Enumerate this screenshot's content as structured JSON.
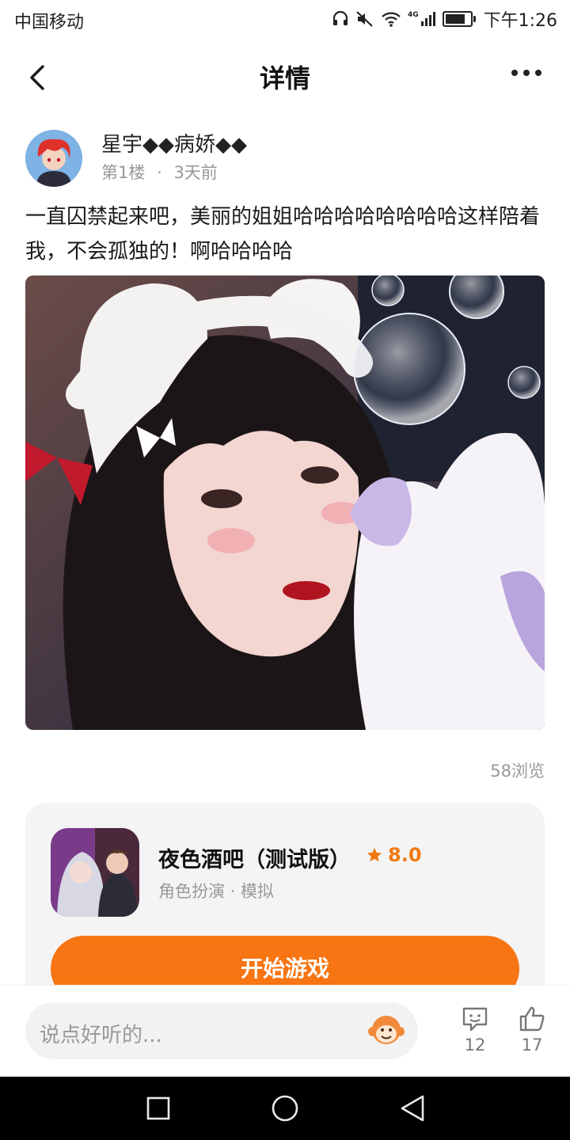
{
  "status_bar": {
    "carrier": "中国移动",
    "network_badge": "4G",
    "time": "下午1:26"
  },
  "header": {
    "title": "详情"
  },
  "post": {
    "author_name": "星宇◆◆病娇◆◆",
    "floor": "第1楼",
    "separator": "·",
    "time_ago": "3天前",
    "text": "一直囚禁起来吧，美丽的姐姐哈哈哈哈哈哈哈哈这样陪着我，不会孤独的！啊哈哈哈哈",
    "views": "58浏览"
  },
  "game_card": {
    "name": "夜色酒吧（测试版）",
    "rating": "8.0",
    "tags": "角色扮演 · 模拟",
    "play_label": "开始游戏"
  },
  "bottom_bar": {
    "comment_placeholder": "说点好听的...",
    "comment_count": "12",
    "like_count": "17"
  },
  "colors": {
    "accent": "#f77512",
    "rating": "#f07a12",
    "muted_text": "#999999",
    "card_bg": "#f4f4f4"
  }
}
